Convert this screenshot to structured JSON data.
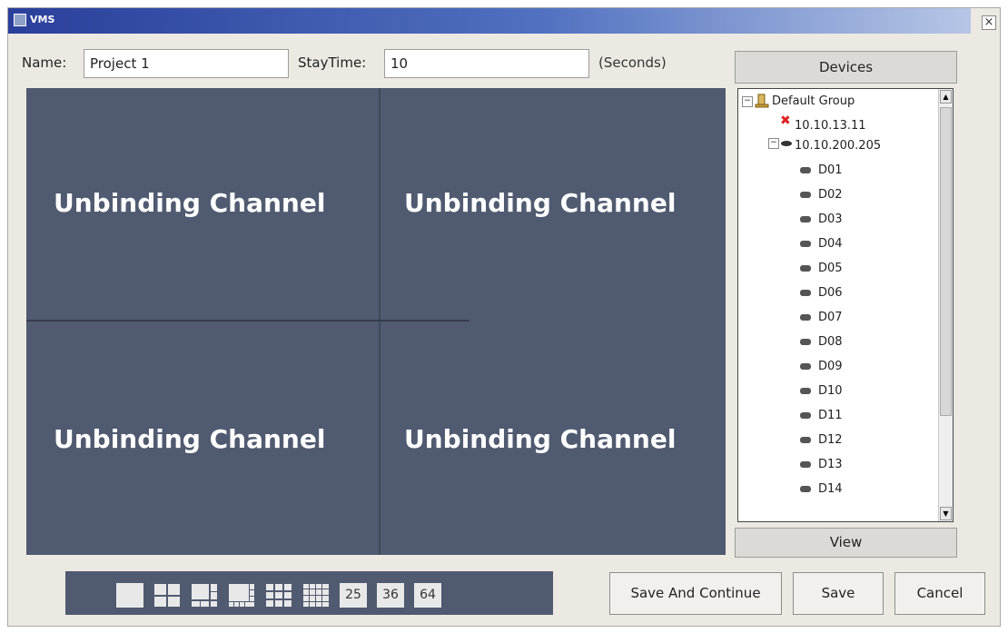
{
  "window": {
    "title": "VMS",
    "close_glyph": "×"
  },
  "form": {
    "name_label": "Name:",
    "name_value": "Project 1",
    "staytime_label": "StayTime:",
    "staytime_value": "10",
    "seconds_label": "(Seconds)"
  },
  "grid": {
    "cells": [
      {
        "label": "Unbinding Channel"
      },
      {
        "label": "Unbinding Channel"
      },
      {
        "label": "Unbinding Channel"
      },
      {
        "label": "Unbinding Channel"
      }
    ]
  },
  "devices": {
    "header": "Devices",
    "group": "Default Group",
    "device_offline": "10.10.13.11",
    "device_online": "10.10.200.205",
    "channels": [
      "D01",
      "D02",
      "D03",
      "D04",
      "D05",
      "D06",
      "D07",
      "D08",
      "D09",
      "D10",
      "D11",
      "D12",
      "D13",
      "D14"
    ],
    "view_button": "View"
  },
  "layouts": {
    "n25": "25",
    "n36": "36",
    "n64": "64"
  },
  "buttons": {
    "save_continue": "Save And Continue",
    "save": "Save",
    "cancel": "Cancel"
  },
  "colors": {
    "titlebar": "#2a3f9a",
    "grid_bg": "#505a70",
    "offline_icon": "#e02020"
  },
  "icons": {
    "app": "app-icon",
    "group": "group-icon",
    "offline": "offline-x-icon",
    "camera": "camera-icon",
    "collapse": "minus-toggle-icon"
  }
}
